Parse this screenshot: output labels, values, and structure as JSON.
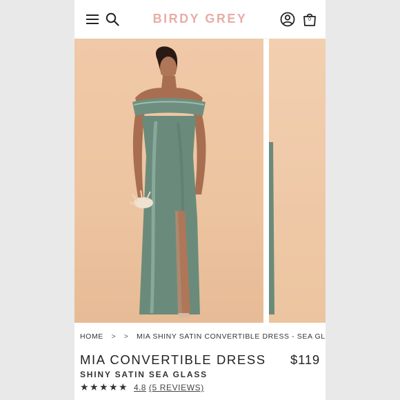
{
  "header": {
    "brand": "BIRDY GREY",
    "cart_count": "0",
    "icons": [
      "menu-icon",
      "search-icon",
      "account-icon",
      "bag-icon"
    ]
  },
  "gallery": {
    "images": [
      "model-in-sea-glass-dress-photo",
      "next-product-photo-preview"
    ]
  },
  "breadcrumb": {
    "home": "HOME",
    "separator": ">",
    "current": "MIA SHINY SATIN CONVERTIBLE DRESS - SEA GLASS"
  },
  "product": {
    "title": "MIA CONVERTIBLE DRESS",
    "price": "$119",
    "subtitle": "SHINY SATIN SEA GLASS",
    "rating_value": "4.8",
    "rating_fraction": 0.96,
    "reviews_label": "(5 REVIEWS)"
  },
  "colors": {
    "brand": "#e6aea6",
    "backdrop": "#edc4a0",
    "dress": "#6e8f7f",
    "text": "#222222"
  }
}
